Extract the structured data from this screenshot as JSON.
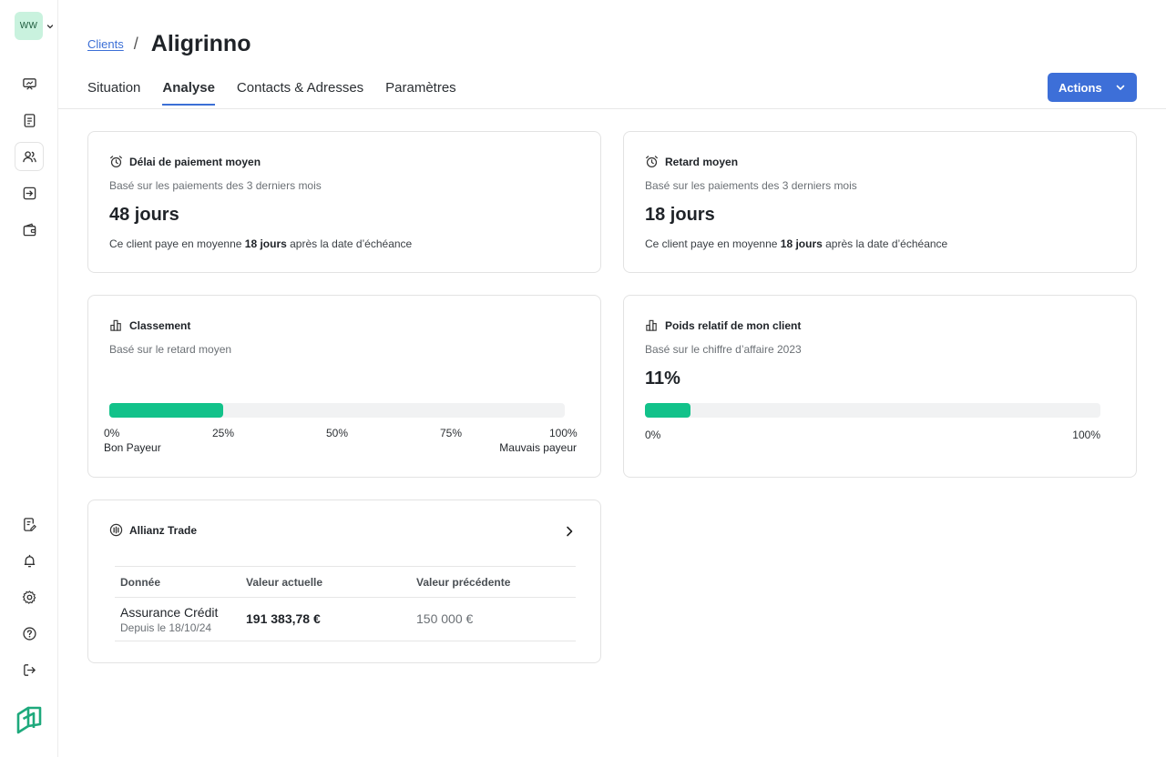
{
  "sidebar": {
    "workspace_initials": "WW",
    "nav_icons": [
      "presentation-icon",
      "document-icon",
      "users-icon",
      "inbox-icon",
      "wallet-icon"
    ],
    "bottom_icons": [
      "edit-document-icon",
      "bell-icon",
      "gear-icon",
      "help-icon",
      "logout-icon"
    ]
  },
  "breadcrumb": {
    "parent": "Clients",
    "current": "Aligrinno"
  },
  "tabs": [
    {
      "label": "Situation",
      "active": false
    },
    {
      "label": "Analyse",
      "active": true
    },
    {
      "label": "Contacts & Adresses",
      "active": false
    },
    {
      "label": "Paramètres",
      "active": false
    }
  ],
  "actions": {
    "label": "Actions"
  },
  "cards": {
    "delai": {
      "title": "Délai de paiement moyen",
      "subtitle": "Basé sur les paiements des 3 derniers mois",
      "value": "48 jours",
      "note_prefix": "Ce client paye en moyenne ",
      "note_bold": "18 jours",
      "note_suffix": " après la date d’échéance"
    },
    "retard": {
      "title": "Retard moyen",
      "subtitle": "Basé sur les paiements des 3 derniers mois",
      "value": "18 jours",
      "note_prefix": "Ce client paye en moyenne ",
      "note_bold": "18 jours",
      "note_suffix": " après la date d’échéance"
    },
    "classement": {
      "title": "Classement",
      "subtitle": "Basé sur le retard moyen",
      "progress": 0.25,
      "ticks": [
        "0%",
        "25%",
        "50%",
        "75%",
        "100%"
      ],
      "label_left": "Bon Payeur",
      "label_right": "Mauvais payeur"
    },
    "poids": {
      "title": "Poids relatif de mon client",
      "subtitle": "Basé sur le chiffre d’affaire 2023",
      "value": "11%",
      "progress": 0.1,
      "tick_min": "0%",
      "tick_max": "100%"
    },
    "allianz": {
      "title": "Allianz Trade",
      "columns": [
        "Donnée",
        "Valeur actuelle",
        "Valeur précédente"
      ],
      "rows": [
        {
          "label": "Assurance Crédit",
          "sub": "Depuis le 18/10/24",
          "current": "191 383,78 €",
          "previous": "150 000 €"
        }
      ]
    }
  },
  "colors": {
    "accent": "#3d6fd8",
    "success": "#12c28a",
    "link": "#3b6fd6"
  }
}
